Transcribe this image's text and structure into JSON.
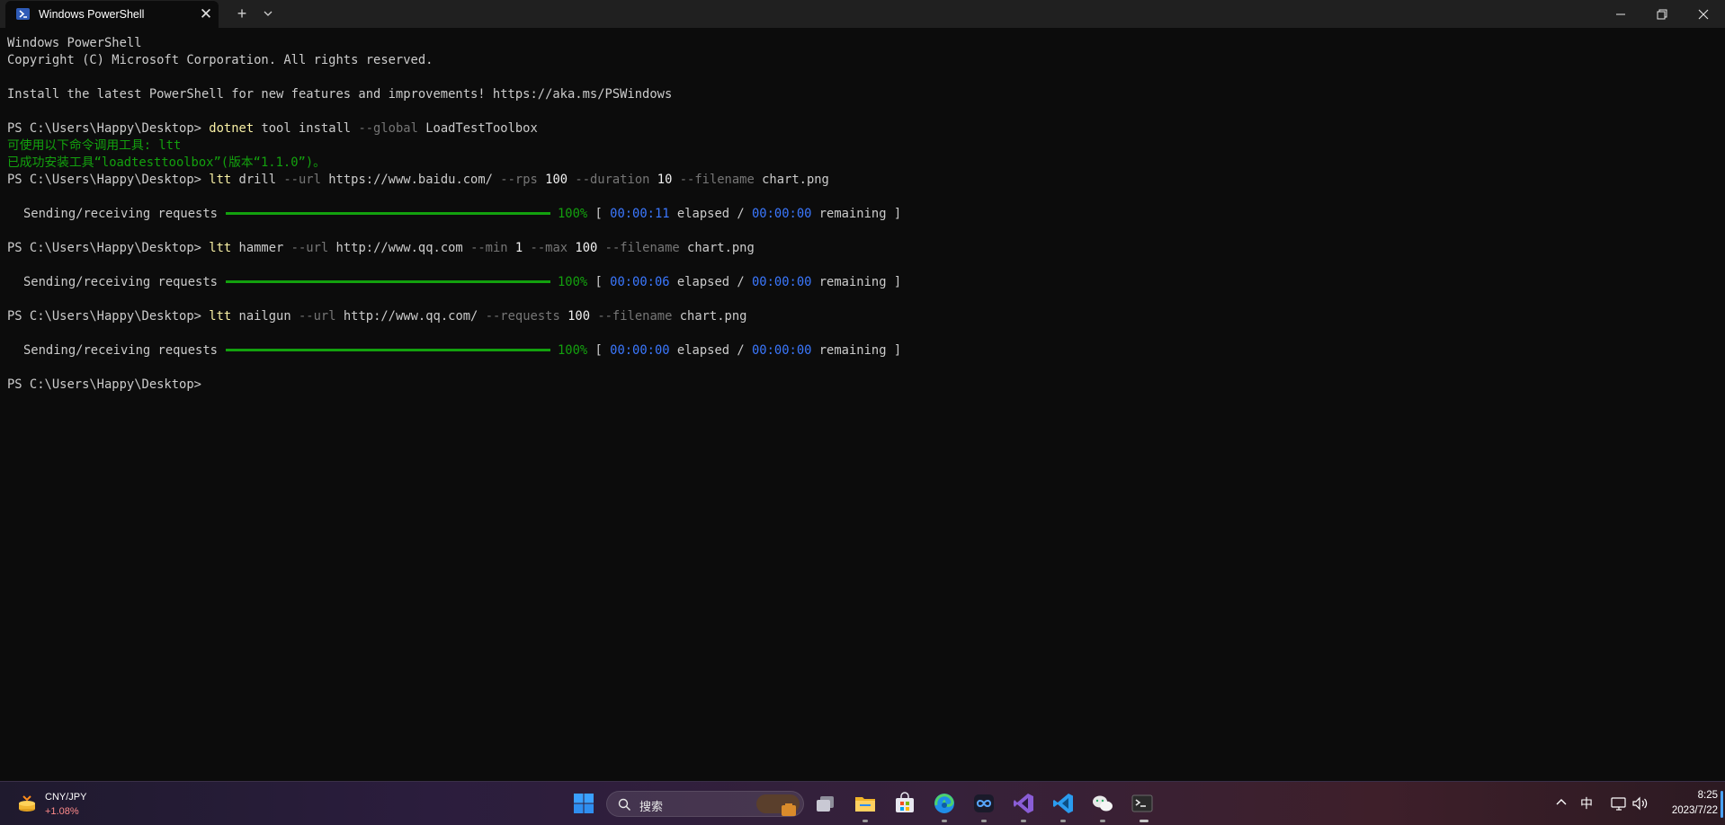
{
  "window": {
    "tab_title": "Windows PowerShell",
    "tab_close_icon": "close-icon",
    "new_tab_label": "+",
    "minimize_icon": "minimize-icon",
    "maximize_icon": "restore-icon",
    "close_icon": "close-icon"
  },
  "terminal": {
    "header1": "Windows PowerShell",
    "header2": "Copyright (C) Microsoft Corporation. All rights reserved.",
    "header3": "Install the latest PowerShell for new features and improvements! https://aka.ms/PSWindows",
    "prompt": "PS C:\\Users\\Happy\\Desktop>",
    "cmd1": {
      "exe": "dotnet",
      "a1": "tool install",
      "f1": "--global",
      "a2": "LoadTestToolbox"
    },
    "install_out1": "可使用以下命令调用工具: ltt",
    "install_out2": "已成功安装工具“loadtesttoolbox”(版本“1.1.0”)。",
    "cmd2": {
      "exe": "ltt",
      "a1": "drill",
      "f1": "--url",
      "a2": "https://www.baidu.com/",
      "f2": "--rps",
      "a3": "100",
      "f3": "--duration",
      "a4": "10",
      "f4": "--filename",
      "a5": "chart.png"
    },
    "cmd3": {
      "exe": "ltt",
      "a1": "hammer",
      "f1": "--url",
      "a2": "http://www.qq.com",
      "f2": "--min",
      "a3": "1",
      "f3": "--max",
      "a4": "100",
      "f4": "--filename",
      "a5": "chart.png"
    },
    "cmd4": {
      "exe": "ltt",
      "a1": "nailgun",
      "f1": "--url",
      "a2": "http://www.qq.com/",
      "f2": "--requests",
      "a3": "100",
      "f3": "--filename",
      "a4": "chart.png"
    },
    "progress_label": "Sending/receiving requests",
    "progress_percent": "100%",
    "progress_fraction": 1.0,
    "open_bracket": "[",
    "close_bracket": "remaining ]",
    "elapsed_word": "elapsed /",
    "runs": [
      {
        "elapsed": "00:00:11",
        "remaining": "00:00:00"
      },
      {
        "elapsed": "00:00:06",
        "remaining": "00:00:00"
      },
      {
        "elapsed": "00:00:00",
        "remaining": "00:00:00"
      }
    ]
  },
  "taskbar": {
    "widget": {
      "name": "CNY/JPY",
      "change": "+1.08%",
      "icon": "currency-widget-icon"
    },
    "search_placeholder": "搜索",
    "apps": [
      "start-icon",
      "task-view-icon",
      "file-explorer-icon",
      "microsoft-store-icon",
      "edge-icon",
      "app-icon",
      "visual-studio-icon",
      "vscode-icon",
      "wechat-icon",
      "terminal-icon"
    ],
    "tray": {
      "ime": "中",
      "time": "8:25",
      "date": "2023/7/22"
    }
  },
  "colors": {
    "terminal_bg": "#0c0c0c",
    "progress": "#13a10e",
    "time_blue": "#3b78ff",
    "command_yellow": "#f9f1a5"
  }
}
